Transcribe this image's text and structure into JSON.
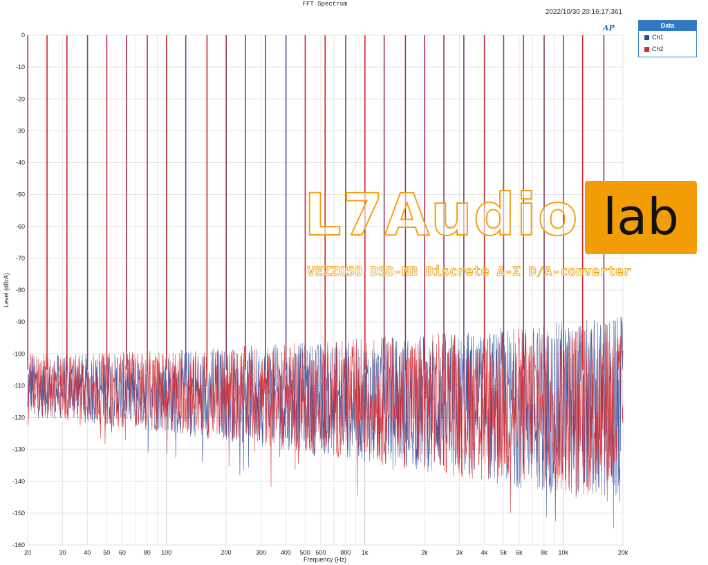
{
  "chart_data": {
    "type": "line",
    "title": "FFT Spectrum",
    "timestamp": "2022/10/30 20:16:17.361",
    "brand_mark": "AP",
    "xlabel": "Frequency (Hz)",
    "ylabel": "Level (dBrA)",
    "x_scale": "log",
    "xlim": [
      20,
      20000
    ],
    "ylim": [
      -160,
      0
    ],
    "grid": true,
    "legend_title": "Data",
    "legend_position": "top-right-outside",
    "xticks": [
      20,
      30,
      40,
      50,
      60,
      80,
      100,
      200,
      300,
      400,
      500,
      600,
      800,
      1000,
      2000,
      3000,
      4000,
      5000,
      6000,
      8000,
      10000,
      20000
    ],
    "xtick_labels": [
      "20",
      "30",
      "40",
      "50",
      "60",
      "80",
      "100",
      "200",
      "300",
      "400",
      "500",
      "600",
      "800",
      "1k",
      "2k",
      "3k",
      "4k",
      "5k",
      "6k",
      "8k",
      "10k",
      "20k"
    ],
    "yticks": [
      0,
      -10,
      -20,
      -30,
      -40,
      -50,
      -60,
      -70,
      -80,
      -90,
      -100,
      -110,
      -120,
      -130,
      -140,
      -150,
      -160
    ],
    "tone_frequencies_hz": [
      20,
      25,
      31.5,
      40,
      50,
      63,
      80,
      100,
      125,
      160,
      200,
      250,
      315,
      400,
      500,
      630,
      800,
      1000,
      1250,
      1600,
      2000,
      2500,
      3150,
      4000,
      5000,
      6300,
      8000,
      10000,
      12500,
      16000
    ],
    "tone_level_dbra": 0,
    "noise_floor": {
      "low_freq_level_dbra": -110,
      "high_freq_level_dbra": -118,
      "low_freq_spread_db": 10,
      "high_freq_spread_db": 30
    },
    "series": [
      {
        "name": "Ch1",
        "color": "#2b4a9a"
      },
      {
        "name": "Ch2",
        "color": "#d8282e"
      }
    ]
  },
  "watermark": {
    "brand_text": "L7Audio",
    "brand_box_text": "lab",
    "subtitle": "VEZZOSO DSD-NB Discrete Δ-Σ D/A-converter"
  }
}
